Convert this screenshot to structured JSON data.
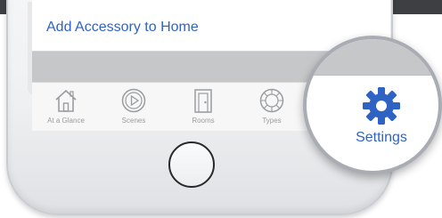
{
  "home": {
    "add_accessory_label": "Add Accessory to Home"
  },
  "tabbar": {
    "tabs": [
      {
        "label": "At a Glance",
        "icon": "house-icon"
      },
      {
        "label": "Scenes",
        "icon": "play-circle-icon"
      },
      {
        "label": "Rooms",
        "icon": "door-icon"
      },
      {
        "label": "Types",
        "icon": "ring-icon"
      }
    ]
  },
  "settings": {
    "label": "Settings",
    "icon": "gear-icon"
  },
  "colors": {
    "accent": "#2e63c4",
    "tab_inactive": "#9a9ca0",
    "gray_band": "#c6c7c9",
    "top_strip": "#3d3f43"
  }
}
